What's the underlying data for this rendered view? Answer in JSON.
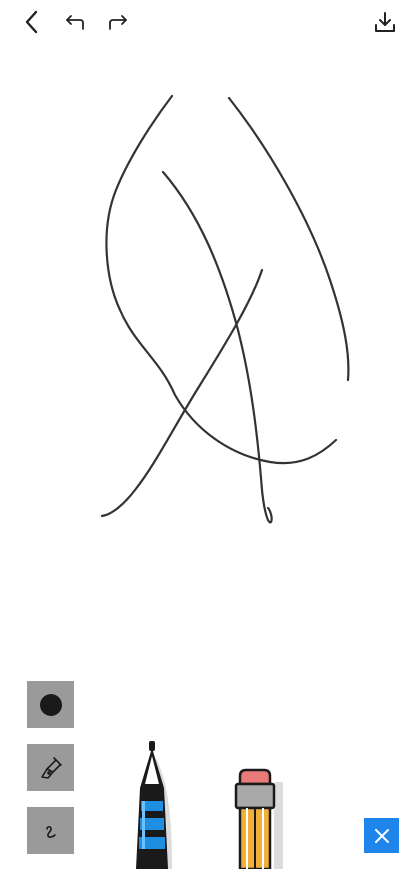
{
  "toolbar": {
    "back_icon": "chevron-left-icon",
    "undo_icon": "undo-arrow-icon",
    "redo_icon": "redo-arrow-icon",
    "download_icon": "download-icon"
  },
  "tools": [
    {
      "name": "brush-size",
      "icon": "circle-dot-icon"
    },
    {
      "name": "pen-tool",
      "icon": "fountain-pen-icon"
    },
    {
      "name": "stroke-style",
      "icon": "squiggle-icon"
    }
  ],
  "instruments": {
    "pen": "marker-pen-icon",
    "pencil": "pencil-icon"
  },
  "colors": {
    "stroke": "#333333",
    "tool_box_bg": "#9a9a9a",
    "close_bg": "#1e86ea",
    "pen_accent": "#1e8fe0",
    "pencil_eraser": "#e97a7a",
    "pencil_body": "#f0b13c"
  }
}
